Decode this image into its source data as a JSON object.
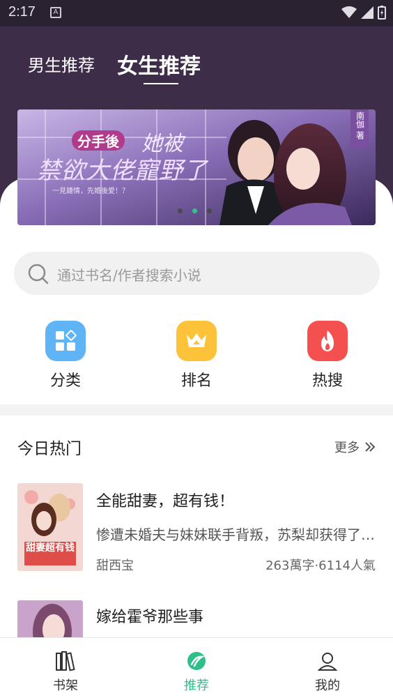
{
  "status_bar": {
    "time": "2:17",
    "indicator": "A"
  },
  "tabs": {
    "male": "男生推荐",
    "female": "女生推荐"
  },
  "banner": {
    "badge": "分手後",
    "title_line1": "她被",
    "title_line2": "禁欲大佬寵野了",
    "tagline": "一見鍾情，先婚後愛！？",
    "author_tag": "南伽 著",
    "slide_count": 3,
    "active_slide": 2
  },
  "search": {
    "placeholder": "通过书名/作者搜索小说"
  },
  "categories": [
    {
      "label": "分类",
      "icon": "grid-icon",
      "color": "#5fb4f6"
    },
    {
      "label": "排名",
      "icon": "crown-icon",
      "color": "#fcc23a"
    },
    {
      "label": "热搜",
      "icon": "flame-icon",
      "color": "#f4504f"
    }
  ],
  "hot": {
    "title": "今日热门",
    "more": "更多",
    "books": [
      {
        "title": "全能甜妻，超有钱！",
        "desc": "惨遭未婚夫与妹妹联手背叛，苏梨却获得了全能系统",
        "author": "甜西宝",
        "meta": "263萬字·6114人氣",
        "cover_text": "甜妻超有钱"
      },
      {
        "title": "嫁给霍爷那些事"
      }
    ]
  },
  "bottom_nav": [
    {
      "label": "书架",
      "icon": "bookshelf-icon"
    },
    {
      "label": "推荐",
      "icon": "recommend-icon"
    },
    {
      "label": "我的",
      "icon": "profile-icon"
    }
  ],
  "colors": {
    "header": "#3d2d49",
    "accent": "#2fbf8a"
  }
}
